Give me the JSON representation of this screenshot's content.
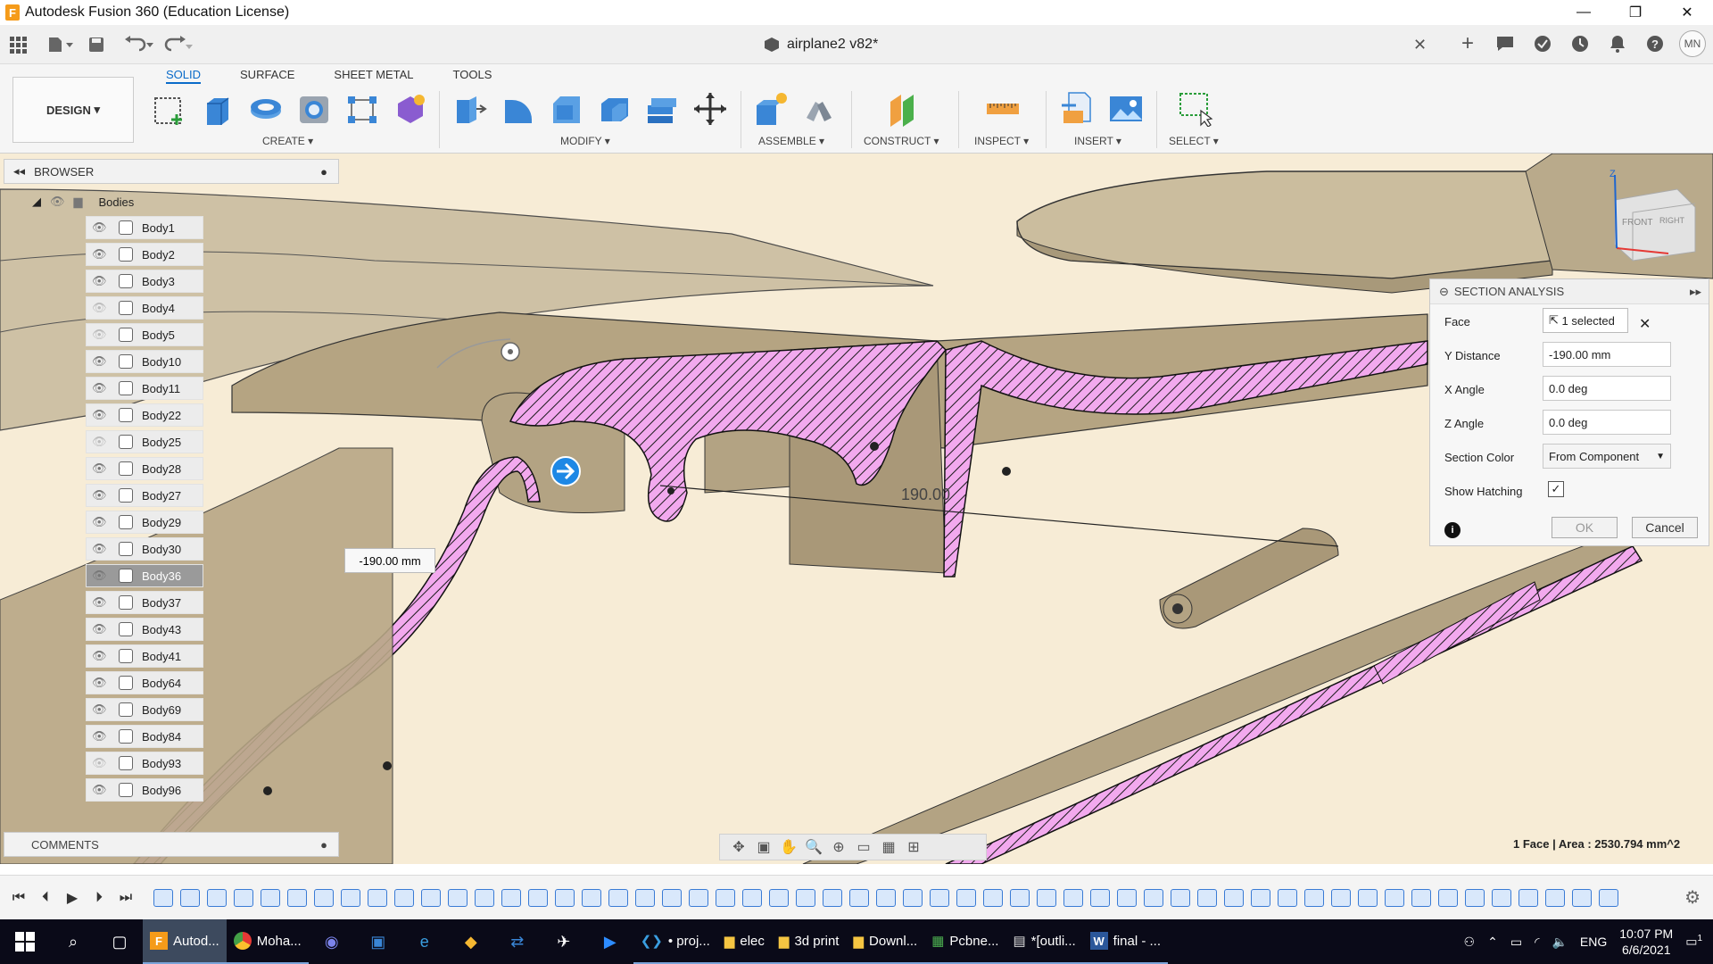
{
  "window": {
    "title": "Autodesk Fusion 360 (Education License)",
    "app_icon_letter": "F",
    "minimize": "—",
    "restore": "❐",
    "close": "✕"
  },
  "document": {
    "tab_title": "airplane2 v82*",
    "user_initials": "MN"
  },
  "ribbon": {
    "workspace": "DESIGN",
    "tabs": [
      "SOLID",
      "SURFACE",
      "SHEET METAL",
      "TOOLS"
    ],
    "groups": [
      "CREATE",
      "MODIFY",
      "ASSEMBLE",
      "CONSTRUCT",
      "INSPECT",
      "INSERT",
      "SELECT"
    ]
  },
  "browser": {
    "title": "BROWSER",
    "folder": "Bodies",
    "items": [
      "Body1",
      "Body2",
      "Body3",
      "Body4",
      "Body5",
      "Body10",
      "Body11",
      "Body22",
      "Body25",
      "Body28",
      "Body27",
      "Body29",
      "Body30",
      "Body36",
      "Body37",
      "Body43",
      "Body41",
      "Body64",
      "Body69",
      "Body84",
      "Body93",
      "Body96"
    ],
    "selected": "Body36"
  },
  "comments": {
    "title": "COMMENTS"
  },
  "section_analysis": {
    "title": "SECTION ANALYSIS",
    "face_label": "Face",
    "face_value": "1 selected",
    "y_distance_label": "Y Distance",
    "y_distance_value": "-190.00 mm",
    "x_angle_label": "X Angle",
    "x_angle_value": "0.0 deg",
    "z_angle_label": "Z Angle",
    "z_angle_value": "0.0 deg",
    "section_color_label": "Section Color",
    "section_color_value": "From Component",
    "show_hatching_label": "Show Hatching",
    "show_hatching_checked": true,
    "ok": "OK",
    "cancel": "Cancel"
  },
  "viewport": {
    "dimension_input": "-190.00 mm",
    "dimension_label": "190.00",
    "viewcube_front": "FRONT",
    "viewcube_right": "RIGHT",
    "axis_z": "Z",
    "status": "1 Face | Area : 2530.794 mm^2"
  },
  "taskbar": {
    "apps": [
      "Autod...",
      "Moha...",
      "• proj...",
      "elec",
      "3d print",
      "Downl...",
      "Pcbne...",
      "*[outli...",
      "final - ..."
    ],
    "language": "ENG",
    "time": "10:07 PM",
    "date": "6/6/2021",
    "notification_count": "1"
  },
  "colors": {
    "accent": "#0a6bc9",
    "hatch": "#f2a9ee",
    "body": "#b8a88a",
    "background": "#f7ecd6"
  }
}
